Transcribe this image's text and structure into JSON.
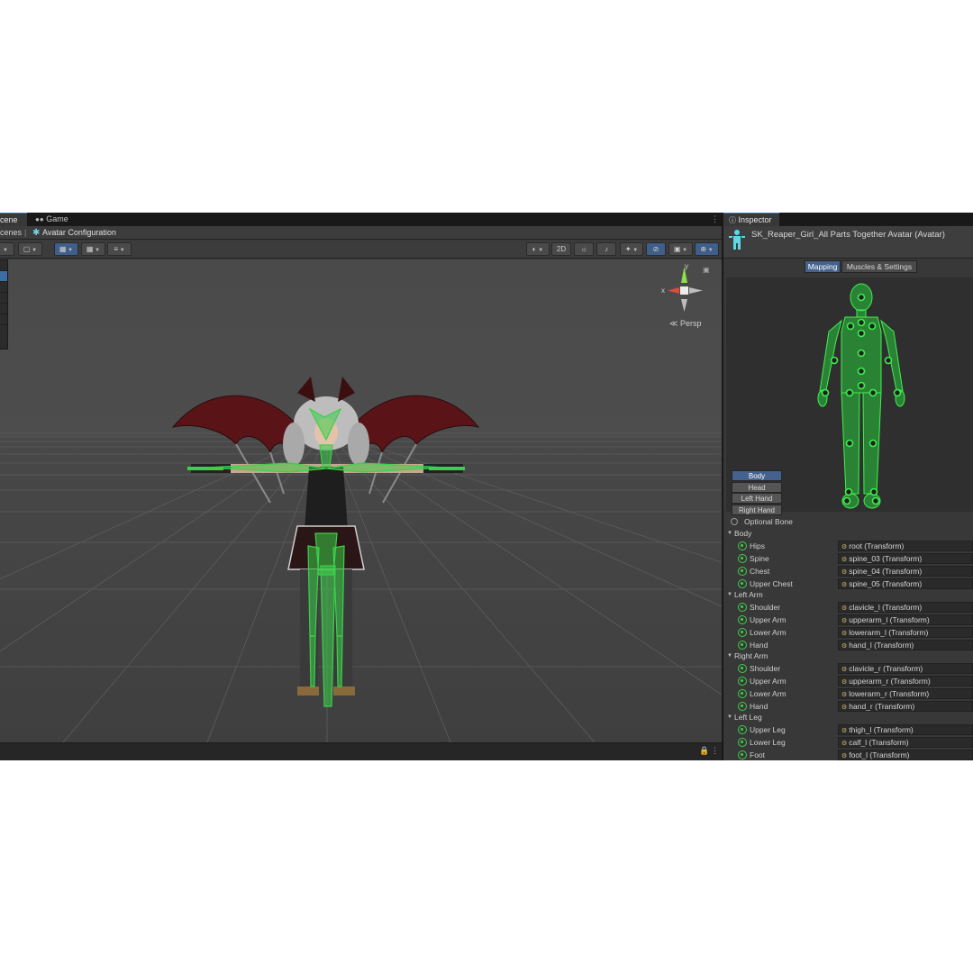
{
  "scene_tabs": {
    "scene": "cene",
    "game": "Game"
  },
  "breadcrumb": {
    "scenes": "cenes",
    "separator": "|",
    "current": "Avatar Configuration"
  },
  "scene_toolbar": {
    "two_d": "2D"
  },
  "viewport": {
    "persp_label": "Persp",
    "gizmo_x": "x",
    "gizmo_y": "y"
  },
  "inspector": {
    "tab": "Inspector",
    "title": "SK_Reaper_Girl_All Parts Together Avatar (Avatar)",
    "mode_tabs": [
      "Mapping",
      "Muscles & Settings"
    ],
    "body_parts": [
      "Body",
      "Head",
      "Left Hand",
      "Right Hand"
    ],
    "optional_bone": "Optional Bone",
    "groups": [
      {
        "name": "Body",
        "bones": [
          {
            "name": "Hips",
            "value": "root (Transform)"
          },
          {
            "name": "Spine",
            "value": "spine_03 (Transform)"
          },
          {
            "name": "Chest",
            "value": "spine_04 (Transform)"
          },
          {
            "name": "Upper Chest",
            "value": "spine_05 (Transform)"
          }
        ]
      },
      {
        "name": "Left Arm",
        "bones": [
          {
            "name": "Shoulder",
            "value": "clavicle_l (Transform)"
          },
          {
            "name": "Upper Arm",
            "value": "upperarm_l (Transform)"
          },
          {
            "name": "Lower Arm",
            "value": "lowerarm_l (Transform)"
          },
          {
            "name": "Hand",
            "value": "hand_l (Transform)"
          }
        ]
      },
      {
        "name": "Right Arm",
        "bones": [
          {
            "name": "Shoulder",
            "value": "clavicle_r (Transform)"
          },
          {
            "name": "Upper Arm",
            "value": "upperarm_r (Transform)"
          },
          {
            "name": "Lower Arm",
            "value": "lowerarm_r (Transform)"
          },
          {
            "name": "Hand",
            "value": "hand_r (Transform)"
          }
        ]
      },
      {
        "name": "Left Leg",
        "bones": [
          {
            "name": "Upper Leg",
            "value": "thigh_l (Transform)"
          },
          {
            "name": "Lower Leg",
            "value": "calf_l (Transform)"
          },
          {
            "name": "Foot",
            "value": "foot_l (Transform)"
          }
        ]
      }
    ]
  },
  "colors": {
    "bone_green": "#3cd04a",
    "accent_blue": "#44628d",
    "panel_bg": "#383838"
  }
}
